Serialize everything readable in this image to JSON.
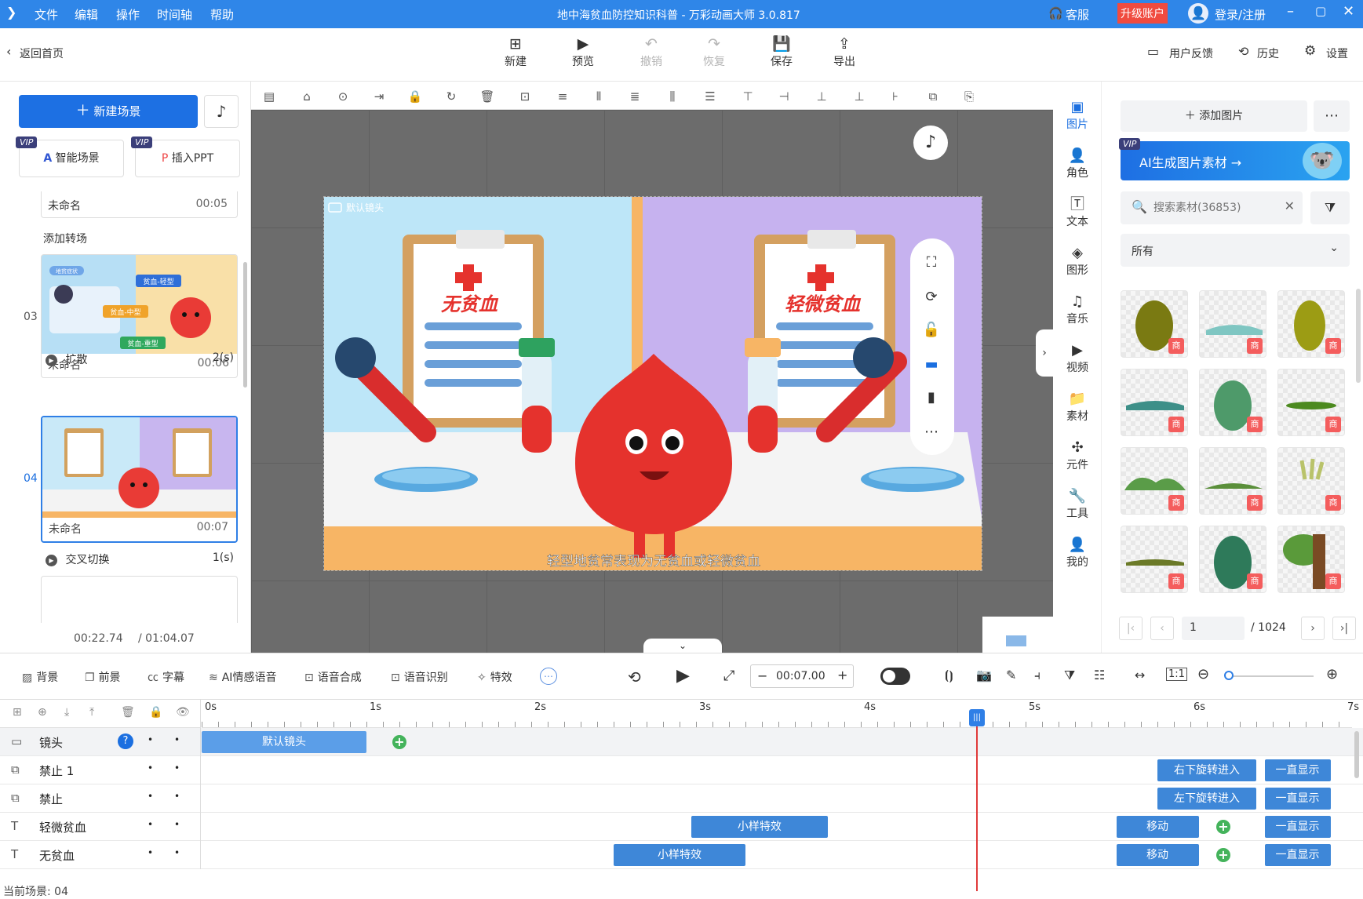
{
  "window": {
    "title": "地中海贫血防控知识科普 - 万彩动画大师 3.0.817",
    "menu": [
      "文件",
      "编辑",
      "操作",
      "时间轴",
      "帮助"
    ],
    "service": "客服",
    "upgrade": "升级账户",
    "login": "登录/注册"
  },
  "toolbar": {
    "back": "返回首页",
    "new": "新建",
    "preview": "预览",
    "undo": "撤销",
    "redo": "恢复",
    "save": "保存",
    "export": "导出",
    "feedback": "用户反馈",
    "history": "历史",
    "settings": "设置"
  },
  "left": {
    "new_scene": "新建场景",
    "vip": "VIP",
    "smart_scene": "智能场景",
    "insert_ppt": "插入PPT",
    "prev_scene": {
      "name": "未命名",
      "time": "00:05"
    },
    "add_transition": "添加转场",
    "scenes": [
      {
        "num": "03",
        "name": "未命名",
        "time": "00:06",
        "transition": "扩散",
        "trans_time": "2(s)",
        "tags": [
          "地贫症状",
          "贫血-轻型",
          "贫血-中型",
          "贫血-重型"
        ]
      },
      {
        "num": "04",
        "name": "未命名",
        "time": "00:07",
        "transition": "交叉切换",
        "trans_time": "1(s)"
      }
    ],
    "current_time": "00:22.74",
    "total_time": "/ 01:04.07"
  },
  "canvas": {
    "camera_label": "默认镜头",
    "sign_left": "无贫血",
    "sign_right": "轻微贫血",
    "subtitle": "轻型地贫常表现为无贫血或轻微贫血"
  },
  "iconnav": [
    {
      "label": "图片",
      "icon": "image-icon",
      "active": true
    },
    {
      "label": "角色",
      "icon": "person-icon"
    },
    {
      "label": "文本",
      "icon": "text-icon"
    },
    {
      "label": "图形",
      "icon": "shape-icon"
    },
    {
      "label": "音乐",
      "icon": "music-icon"
    },
    {
      "label": "视频",
      "icon": "video-icon"
    },
    {
      "label": "素材",
      "icon": "folder-icon"
    },
    {
      "label": "元件",
      "icon": "pinwheel-icon"
    },
    {
      "label": "工具",
      "icon": "wrench-icon"
    },
    {
      "label": "我的",
      "icon": "user-icon"
    }
  ],
  "right": {
    "add_image": "添加图片",
    "ai_banner": "AI生成图片素材 →",
    "search_placeholder": "搜索素材(36853)",
    "filter": "所有",
    "asset_badge": "商",
    "page_current": "1",
    "page_total": "/ 1024"
  },
  "timeline": {
    "tools": [
      "背景",
      "前景",
      "字幕",
      "AI情感语音",
      "语音合成",
      "语音识别",
      "特效"
    ],
    "time": "00:07.00",
    "ruler": [
      "0s",
      "1s",
      "2s",
      "3s",
      "4s",
      "5s",
      "6s",
      "7s"
    ],
    "playhead_sec": 4.7,
    "tracks": [
      {
        "name": "镜头",
        "icon": "camera-icon",
        "clips": [
          {
            "label": "默认镜头",
            "start": 0,
            "end": 1.0
          }
        ],
        "keyframes": [
          1.2
        ]
      },
      {
        "name": "禁止 1",
        "icon": "svg-icon",
        "clips": [
          {
            "label": "右下旋转进入",
            "start": 5.8,
            "end": 6.4
          },
          {
            "label": "一直显示",
            "start": 6.45,
            "end": 6.85
          }
        ],
        "keyframes": []
      },
      {
        "name": "禁止",
        "icon": "svg-icon",
        "clips": [
          {
            "label": "左下旋转进入",
            "start": 5.8,
            "end": 6.4
          },
          {
            "label": "一直显示",
            "start": 6.45,
            "end": 6.85
          }
        ],
        "keyframes": []
      },
      {
        "name": "轻微贫血",
        "icon": "text-t-icon",
        "clips": [
          {
            "label": "小样特效",
            "start": 2.97,
            "end": 3.8
          },
          {
            "label": "移动",
            "start": 5.55,
            "end": 6.05
          },
          {
            "label": "一直显示",
            "start": 6.45,
            "end": 6.85
          }
        ],
        "keyframes": [
          6.2
        ]
      },
      {
        "name": "无贫血",
        "icon": "text-t-icon",
        "clips": [
          {
            "label": "小样特效",
            "start": 2.5,
            "end": 3.3
          },
          {
            "label": "移动",
            "start": 5.55,
            "end": 6.05
          },
          {
            "label": "一直显示",
            "start": 6.45,
            "end": 6.85
          }
        ],
        "keyframes": [
          6.2
        ]
      }
    ],
    "current_scene": "当前场景: 04"
  }
}
